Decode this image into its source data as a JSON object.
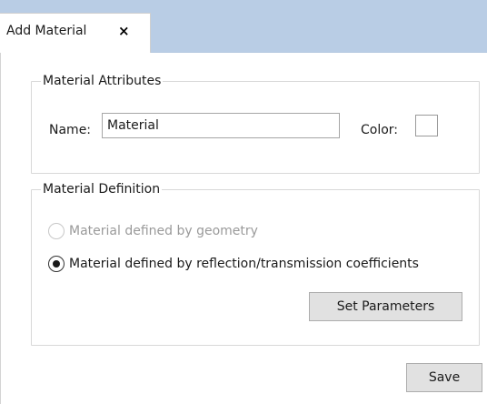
{
  "tab": {
    "label": "Add Material",
    "close_glyph": "×"
  },
  "attributes": {
    "legend": "Material Attributes",
    "name_label": "Name:",
    "name_value": "Material",
    "color_label": "Color:",
    "color_value": "#ffffff"
  },
  "definition": {
    "legend": "Material Definition",
    "options": [
      {
        "label": "Material defined by geometry",
        "selected": false,
        "enabled": false
      },
      {
        "label": "Material defined by reflection/transmission coefficients",
        "selected": true,
        "enabled": true
      }
    ],
    "set_parameters_label": "Set Parameters"
  },
  "save_label": "Save"
}
